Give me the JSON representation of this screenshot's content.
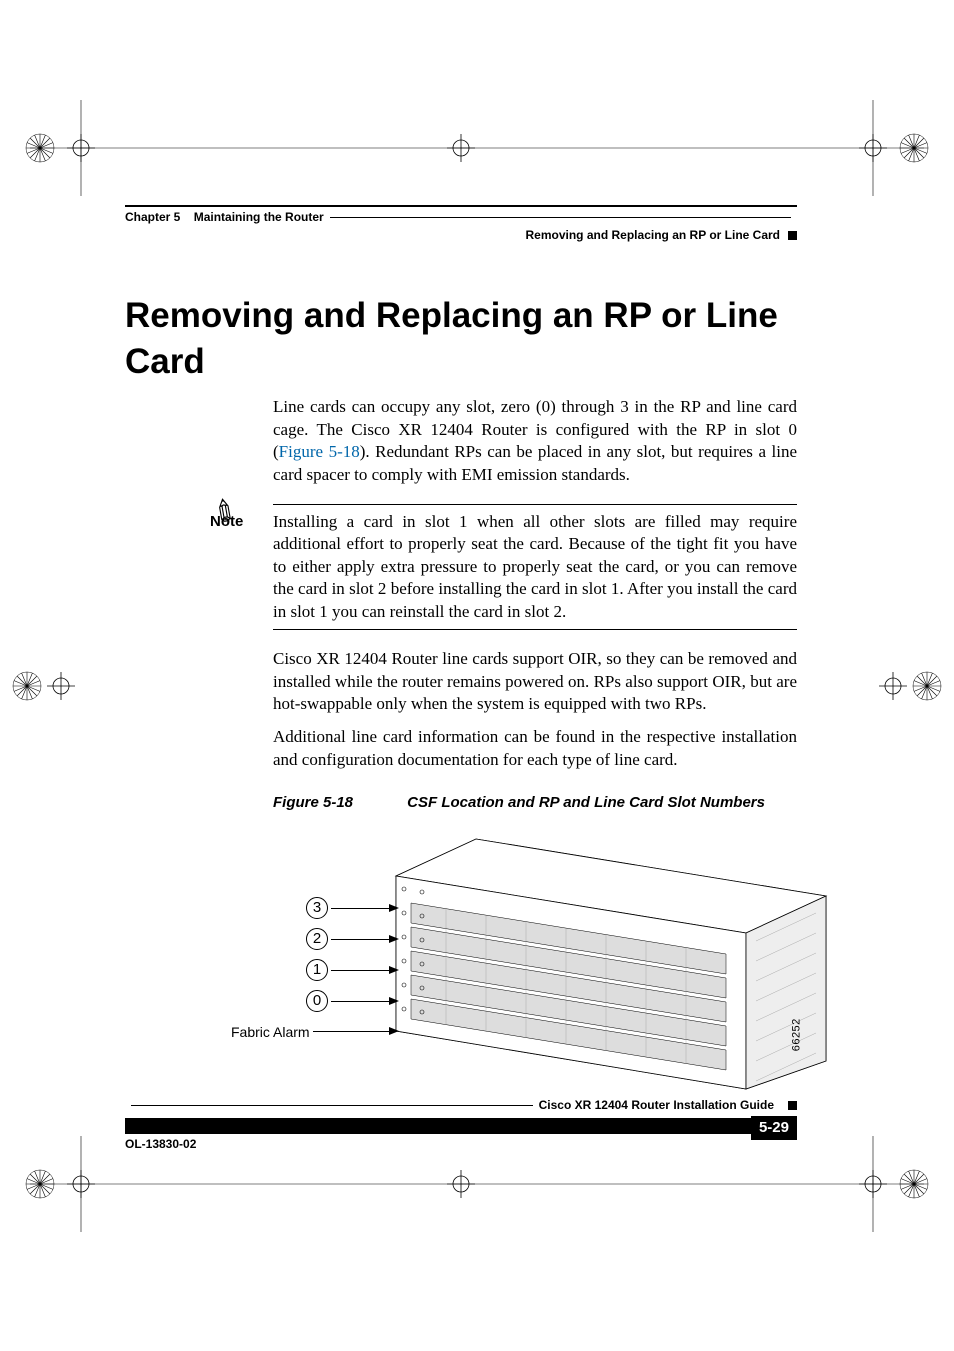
{
  "header": {
    "chapter": "Chapter 5",
    "chapter_title": "Maintaining the Router",
    "section": "Removing and Replacing an RP or Line Card"
  },
  "title": "Removing and Replacing an RP or Line Card",
  "intro_p1_a": "Line cards can occupy any slot, zero (0) through 3 in the RP and line card cage. The Cisco XR 12404 Router is configured with the RP in slot 0 (",
  "intro_link": "Figure 5-18",
  "intro_p1_b": "). Redundant RPs can be placed in any slot, but requires a line card spacer to comply with EMI emission standards.",
  "note_label": "Note",
  "note_text": "Installing a card in slot 1 when all other slots are filled may require additional effort to properly seat the card. Because of the tight fit you have to either apply extra pressure to properly seat the card, or you can remove the card in slot 2 before installing the card in slot 1. After you install the card in slot 1 you can reinstall the card in slot 2.",
  "p2": "Cisco XR 12404 Router line cards support OIR, so they can be removed and installed while the router remains powered on. RPs also support OIR, but are hot-swappable only when the system is equipped with two RPs.",
  "p3": "Additional line card information can be found in the respective installation and configuration documentation for each type of line card.",
  "figure": {
    "num": "Figure 5-18",
    "title": "CSF Location and RP and Line Card Slot Numbers",
    "callouts": [
      "3",
      "2",
      "1",
      "0"
    ],
    "bottom_label": "Fabric Alarm",
    "image_id": "66252"
  },
  "footer": {
    "guide": "Cisco XR 12404 Router Installation Guide",
    "docnum": "OL-13830-02",
    "pagenum": "5-29"
  }
}
